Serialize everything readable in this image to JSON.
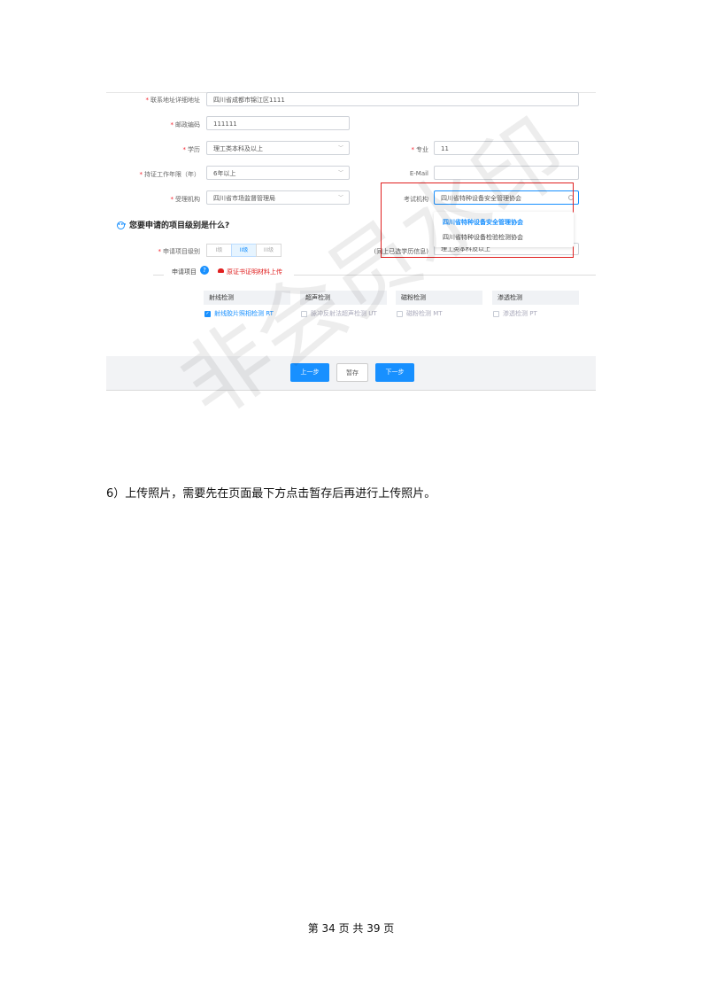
{
  "form": {
    "address": {
      "label": "联系地址详细地址",
      "value": "四川省成都市锦江区1111"
    },
    "postcode": {
      "label": "邮政编码",
      "value": "111111"
    },
    "education": {
      "label": "学历",
      "value": "理工类本科及以上"
    },
    "major": {
      "label": "专业",
      "value": "11"
    },
    "work_years": {
      "label": "持证工作年限（年）",
      "value": "6年以上"
    },
    "email": {
      "label": "E-Mail",
      "value": ""
    },
    "accept_org": {
      "label": "受理机构",
      "value": "四川省市场监督管理局"
    },
    "exam_org": {
      "label": "考试机构",
      "value": "四川省特种设备安全管理协会"
    },
    "exam_org_options": [
      "四川省特种设备安全管理协会",
      "四川省特种设备检验检测协会"
    ],
    "question": "您要申请的项目级别是什么?",
    "level": {
      "label": "申请项目级别",
      "options": [
        "I级",
        "II级",
        "III级"
      ],
      "selected": "II级"
    },
    "same_as_edu": {
      "label": "(同上已选学历信息)",
      "value": "理工类本科及以上"
    },
    "project_section": {
      "label": "申请项目",
      "upload_link": "原证书证明材料上传"
    },
    "categories": [
      {
        "title": "射线检测",
        "option": "射线胶片照相检测 RT",
        "checked": true
      },
      {
        "title": "超声检测",
        "option": "脉冲反射法超声检测 UT",
        "checked": false
      },
      {
        "title": "磁粉检测",
        "option": "磁粉检测 MT",
        "checked": false
      },
      {
        "title": "渗透检测",
        "option": "渗透检测 PT",
        "checked": false
      }
    ],
    "buttons": {
      "prev": "上一步",
      "save": "暂存",
      "next": "下一步"
    }
  },
  "watermark": "非会员水印",
  "paragraph": "6）上传照片，需要先在页面最下方点击暂存后再进行上传照片。",
  "page_number": "第 34 页 共 39 页",
  "colors": {
    "primary": "#1890ff",
    "required": "#f5222d",
    "highlight_box": "#e02020"
  }
}
